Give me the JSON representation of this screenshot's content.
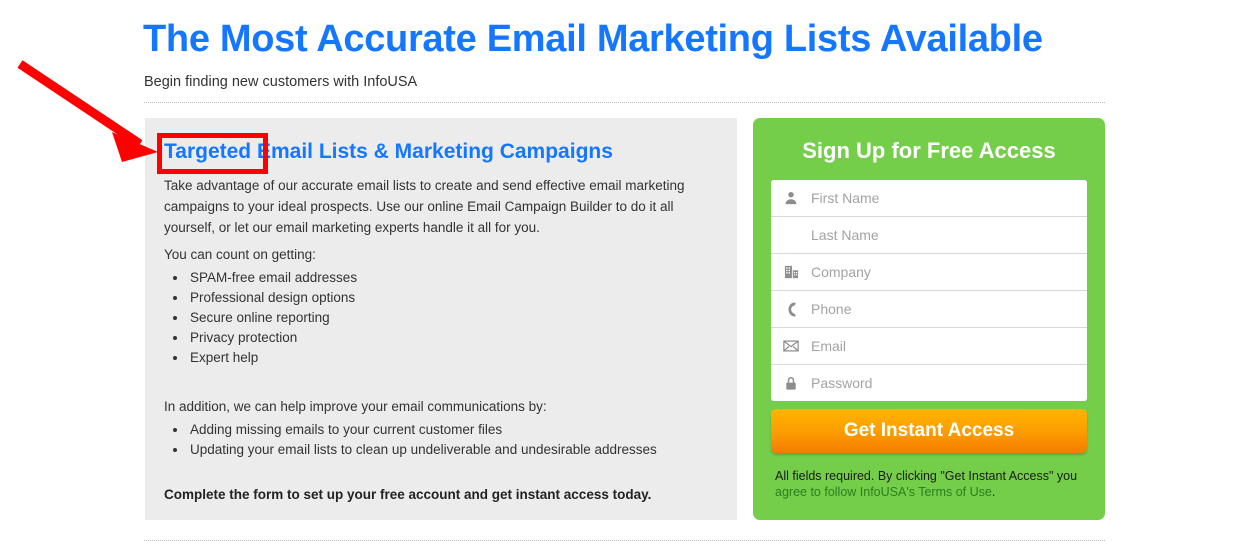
{
  "header": {
    "headline": "The Most Accurate Email Marketing Lists Available",
    "subhead": "Begin finding new customers with InfoUSA"
  },
  "info_panel": {
    "title_highlight": "Targeted",
    "title_rest": " Email Lists & Marketing Campaigns",
    "paragraph": "Take advantage of our accurate email lists to create and send effective email marketing campaigns to your ideal prospects. Use our online Email Campaign Builder to do it all yourself, or let our email marketing experts handle it all for you.",
    "lead_in_1": "You can count on getting:",
    "benefits": [
      "SPAM-free email addresses",
      "Professional design options",
      "Secure online reporting",
      "Privacy protection",
      "Expert help"
    ],
    "lead_in_2": "In addition, we can help improve your email communications by:",
    "improvements": [
      "Adding missing emails to your current customer files",
      "Updating your email lists to clean up undeliverable and undesirable addresses"
    ],
    "closing": "Complete the form to set up your free account and get instant access today."
  },
  "signup": {
    "title": "Sign Up for Free Access",
    "fields": [
      {
        "icon": "user-icon",
        "placeholder": "First Name"
      },
      {
        "icon": "none",
        "placeholder": "Last Name"
      },
      {
        "icon": "building-icon",
        "placeholder": "Company"
      },
      {
        "icon": "phone-icon",
        "placeholder": "Phone"
      },
      {
        "icon": "envelope-icon",
        "placeholder": "Email"
      },
      {
        "icon": "lock-icon",
        "placeholder": "Password"
      }
    ],
    "submit_label": "Get Instant Access",
    "fineprint_before": "All fields required. By clicking \"Get Instant Access\" you ",
    "fineprint_link": "agree to follow InfoUSA's Terms of Use",
    "fineprint_after": "."
  },
  "annotation": {
    "arrow_color": "#FF0000",
    "box_color": "#FF0000",
    "target": "Targeted"
  },
  "colors": {
    "headline_blue": "#1577FF",
    "panel_gray": "#ECECEC",
    "brand_green": "#74CE4A",
    "button_orange_top": "#FFB400",
    "button_orange_bottom": "#F57C00",
    "link_green": "#2E7D1E"
  }
}
